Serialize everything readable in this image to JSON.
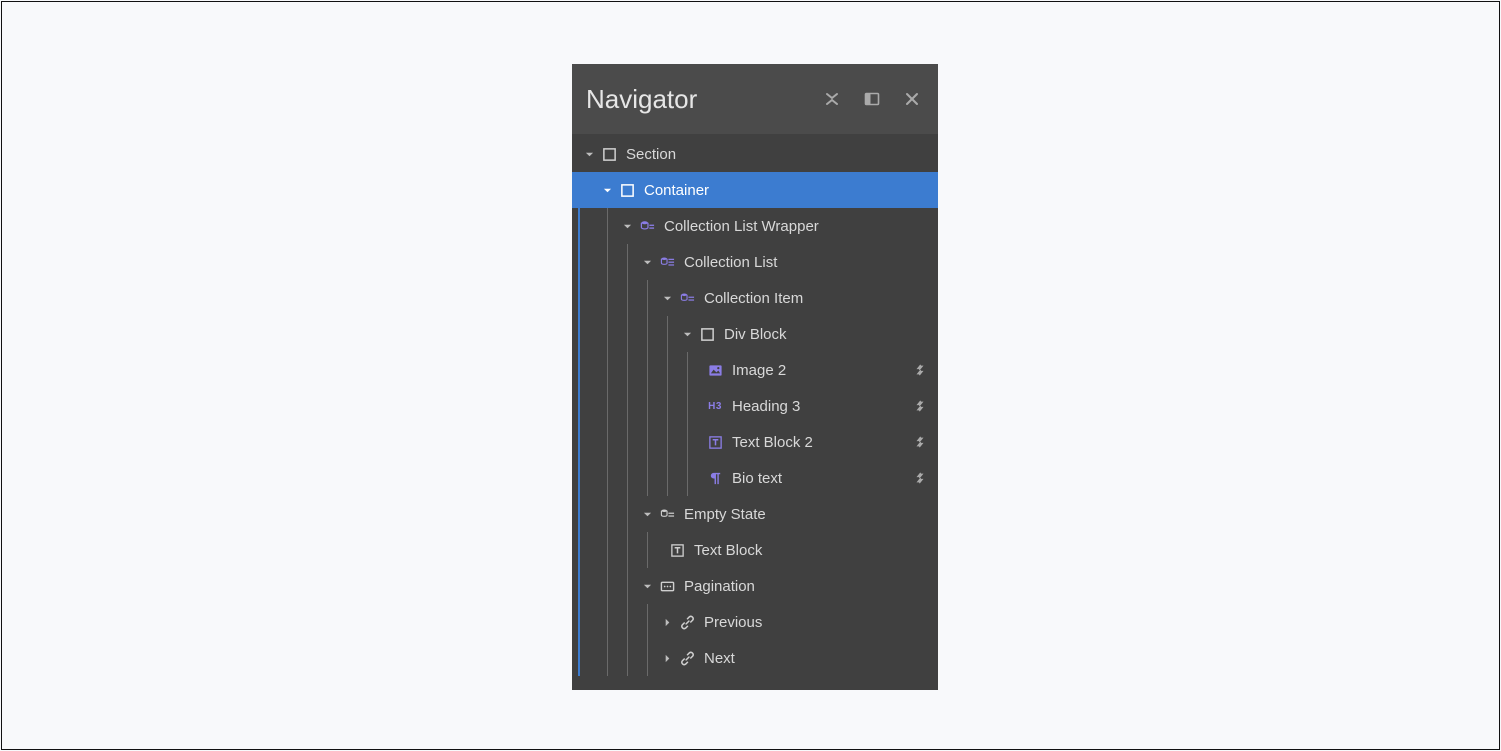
{
  "panel": {
    "title": "Navigator"
  },
  "tree": {
    "section": "Section",
    "container": "Container",
    "clw": "Collection List Wrapper",
    "cl": "Collection List",
    "ci": "Collection Item",
    "divblock": "Div Block",
    "image2": "Image 2",
    "heading3": "Heading 3",
    "textblock2": "Text Block 2",
    "biotext": "Bio text",
    "emptystate": "Empty State",
    "textblock": "Text Block",
    "pagination": "Pagination",
    "previous": "Previous",
    "next": "Next"
  },
  "icons": {
    "collapse": "collapse-icon",
    "dock": "dock-panel-icon",
    "close": "close-icon",
    "cms": "cms-bind-icon"
  },
  "colors": {
    "selected": "#3c7cd0",
    "purple": "#8b7de6"
  }
}
